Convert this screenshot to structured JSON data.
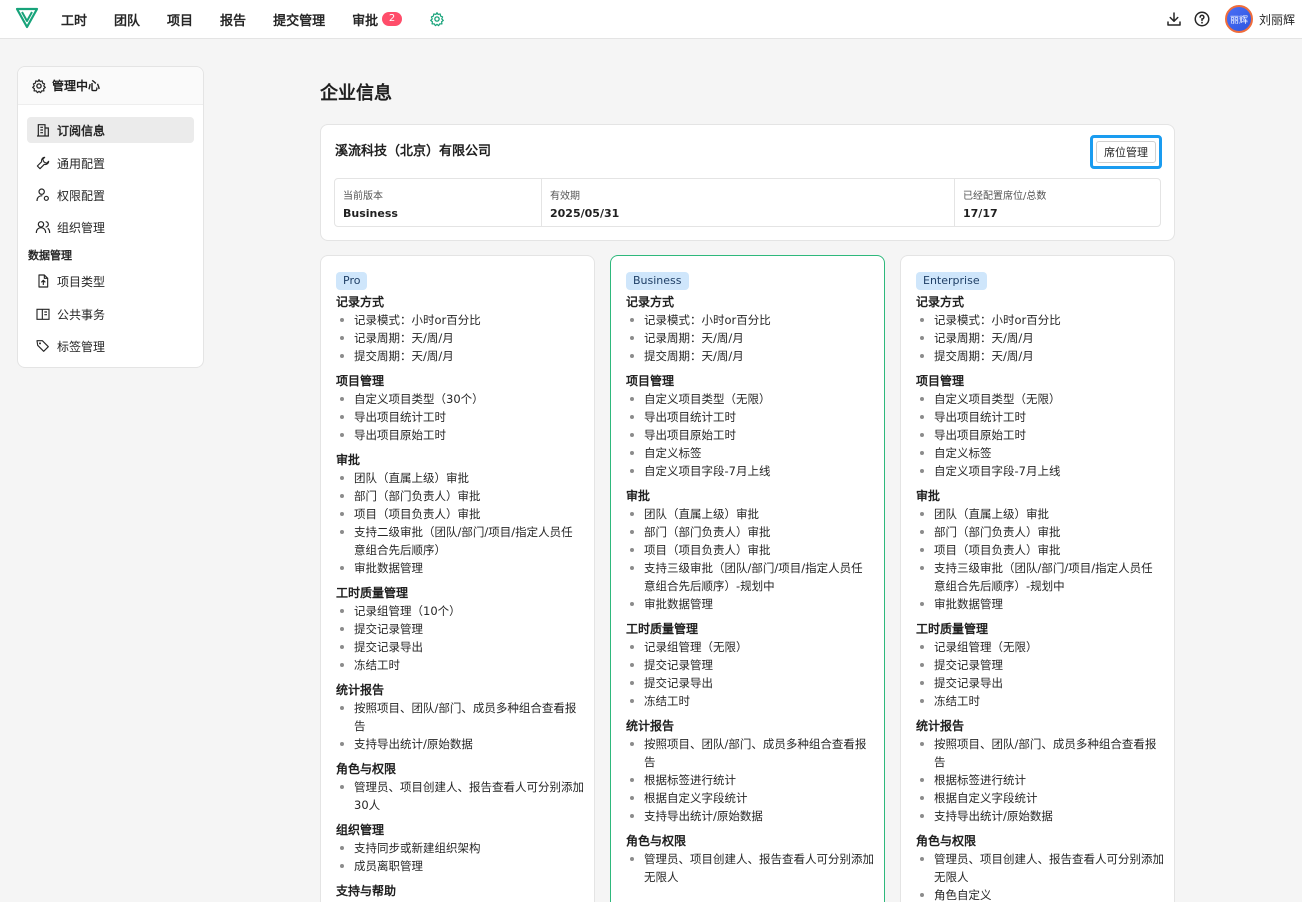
{
  "topbar": {
    "nav": [
      {
        "label": "工时"
      },
      {
        "label": "团队"
      },
      {
        "label": "项目"
      },
      {
        "label": "报告"
      },
      {
        "label": "提交管理"
      },
      {
        "label": "审批",
        "badge": "2"
      }
    ],
    "icons": [
      "download-icon",
      "help-icon"
    ],
    "user": {
      "avatar_text": "丽辉",
      "name": "刘丽辉"
    }
  },
  "sidebar": {
    "title": "管理中心",
    "items": [
      {
        "label": "订阅信息",
        "icon": "building-icon",
        "active": true
      },
      {
        "label": "通用配置",
        "icon": "wrench-icon"
      },
      {
        "label": "权限配置",
        "icon": "user-key-icon"
      },
      {
        "label": "组织管理",
        "icon": "users-icon"
      }
    ],
    "group_label": "数据管理",
    "group_items": [
      {
        "label": "项目类型",
        "icon": "file-upload-icon"
      },
      {
        "label": "公共事务",
        "icon": "book-icon"
      },
      {
        "label": "标签管理",
        "icon": "tags-icon"
      }
    ]
  },
  "main": {
    "title": "企业信息",
    "company": "溪流科技（北京）有限公司",
    "seat_button": "席位管理",
    "info": [
      {
        "label": "当前版本",
        "value": "Business"
      },
      {
        "label": "有效期",
        "value": "2025/05/31"
      },
      {
        "label": "已经配置席位/总数",
        "value": "17/17"
      }
    ]
  },
  "plans": [
    {
      "name": "Pro",
      "sections": [
        {
          "title": "记录方式",
          "items": [
            "记录模式：小时or百分比",
            "记录周期：天/周/月",
            "提交周期：天/周/月"
          ]
        },
        {
          "title": "项目管理",
          "items": [
            "自定义项目类型（30个）",
            "导出项目统计工时",
            "导出项目原始工时"
          ]
        },
        {
          "title": "审批",
          "items": [
            "团队（直属上级）审批",
            "部门（部门负责人）审批",
            "项目（项目负责人）审批",
            "支持二级审批（团队/部门/项目/指定人员任意组合先后顺序）",
            "审批数据管理"
          ]
        },
        {
          "title": "工时质量管理",
          "items": [
            "记录组管理（10个）",
            "提交记录管理",
            "提交记录导出",
            "冻结工时"
          ]
        },
        {
          "title": "统计报告",
          "items": [
            "按照项目、团队/部门、成员多种组合查看报告",
            "支持导出统计/原始数据"
          ]
        },
        {
          "title": "角色与权限",
          "items": [
            "管理员、项目创建人、报告查看人可分别添加30人"
          ]
        },
        {
          "title": "组织管理",
          "items": [
            "支持同步或新建组织架构",
            "成员离职管理"
          ]
        },
        {
          "title": "支持与帮助",
          "items": []
        }
      ]
    },
    {
      "name": "Business",
      "sections": [
        {
          "title": "记录方式",
          "items": [
            "记录模式：小时or百分比",
            "记录周期：天/周/月",
            "提交周期：天/周/月"
          ]
        },
        {
          "title": "项目管理",
          "items": [
            "自定义项目类型（无限）",
            "导出项目统计工时",
            "导出项目原始工时",
            "自定义标签",
            "自定义项目字段-7月上线"
          ]
        },
        {
          "title": "审批",
          "items": [
            "团队（直属上级）审批",
            "部门（部门负责人）审批",
            "项目（项目负责人）审批",
            "支持三级审批（团队/部门/项目/指定人员任意组合先后顺序）-规划中",
            "审批数据管理"
          ]
        },
        {
          "title": "工时质量管理",
          "items": [
            "记录组管理（无限）",
            "提交记录管理",
            "提交记录导出",
            "冻结工时"
          ]
        },
        {
          "title": "统计报告",
          "items": [
            "按照项目、团队/部门、成员多种组合查看报告",
            "根据标签进行统计",
            "根据自定义字段统计",
            "支持导出统计/原始数据"
          ]
        },
        {
          "title": "角色与权限",
          "items": [
            "管理员、项目创建人、报告查看人可分别添加无限人"
          ]
        }
      ]
    },
    {
      "name": "Enterprise",
      "sections": [
        {
          "title": "记录方式",
          "items": [
            "记录模式：小时or百分比",
            "记录周期：天/周/月",
            "提交周期：天/周/月"
          ]
        },
        {
          "title": "项目管理",
          "items": [
            "自定义项目类型（无限）",
            "导出项目统计工时",
            "导出项目原始工时",
            "自定义标签",
            "自定义项目字段-7月上线"
          ]
        },
        {
          "title": "审批",
          "items": [
            "团队（直属上级）审批",
            "部门（部门负责人）审批",
            "项目（项目负责人）审批",
            "支持三级审批（团队/部门/项目/指定人员任意组合先后顺序）-规划中",
            "审批数据管理"
          ]
        },
        {
          "title": "工时质量管理",
          "items": [
            "记录组管理（无限）",
            "提交记录管理",
            "提交记录导出",
            "冻结工时"
          ]
        },
        {
          "title": "统计报告",
          "items": [
            "按照项目、团队/部门、成员多种组合查看报告",
            "根据标签进行统计",
            "根据自定义字段统计",
            "支持导出统计/原始数据"
          ]
        },
        {
          "title": "角色与权限",
          "items": [
            "管理员、项目创建人、报告查看人可分别添加无限人",
            "角色自定义"
          ]
        }
      ]
    }
  ],
  "colors": {
    "current_plan_border": "#2eb87c",
    "tag_bg": "#cfe6fb",
    "badge": "#ff4d6a",
    "focus": "#1a9cf0"
  }
}
